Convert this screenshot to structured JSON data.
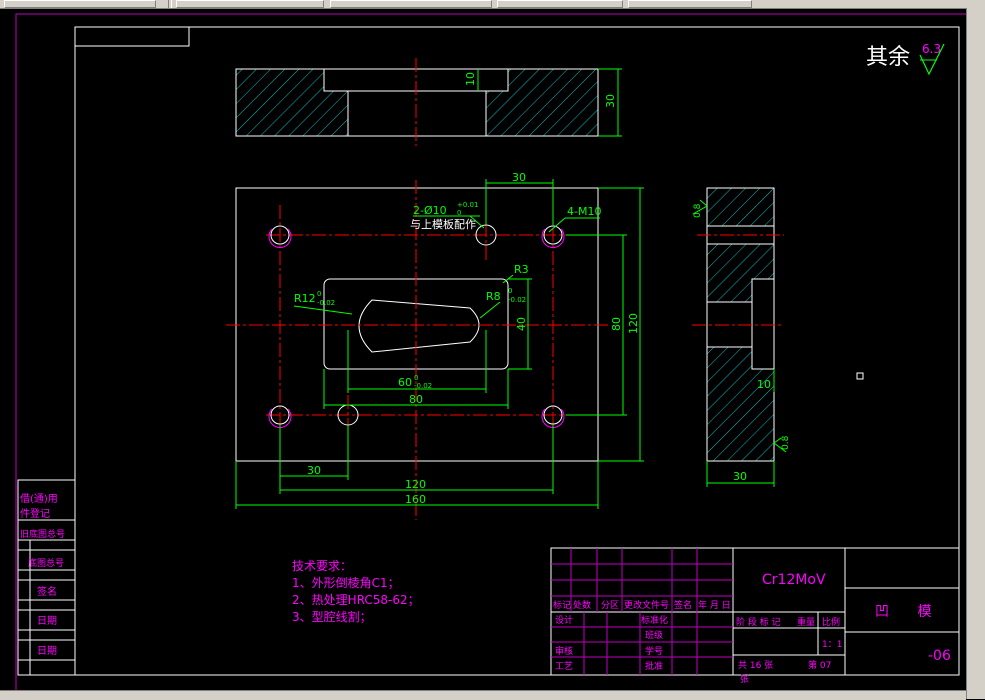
{
  "colors": {
    "background": "#000000",
    "border": "#c000c0",
    "outline": "#ffffff",
    "center_line": "#ff0000",
    "dimension": "#00ff00",
    "hatch": "#00c0c0",
    "notes": "#ff00ff"
  },
  "toolbar": {
    "items": [
      "toolbar-control-1",
      "toolbar-control-2",
      "toolbar-control-3",
      "toolbar-control-4",
      "toolbar-control-5"
    ]
  },
  "drawing": {
    "roughness_label": "其余",
    "roughness_value": "6.3",
    "top_view": {
      "dim_depth": "10",
      "dim_height": "30"
    },
    "plan_view": {
      "dim_hole_spacing": "30",
      "note_holes": "2-Ø10",
      "note_holes_tol": "+0.01",
      "note_holes_tol_low": "0",
      "note_fit": "与上模板配作",
      "note_thread": "4-M10",
      "note_r3": "R3",
      "note_r12": "R12",
      "note_r12_tol_up": "0",
      "note_r12_tol_low": "-0.02",
      "note_r8": "R8",
      "note_r8_tol_up": "0",
      "note_r8_tol_low": "-0.02",
      "dim_40": "40",
      "dim_80_v": "80",
      "dim_120_v": "120",
      "dim_60": "60",
      "dim_60_tol_up": "0",
      "dim_60_tol_low": "-0.02",
      "dim_80_h": "80",
      "dim_30_bottom": "30",
      "dim_120_h": "120",
      "dim_160": "160"
    },
    "side_view": {
      "roughness_top": "0.8",
      "dim_10": "10",
      "roughness_bottom": "0.8",
      "dim_30": "30"
    },
    "notes": {
      "title": "技术要求：",
      "line1": "1、外形倒棱角C1；",
      "line2": "2、热处理HRC58-62；",
      "line3": "3、型腔线割；"
    },
    "left_strip": {
      "field1": "借(通)用",
      "field2": "件登记",
      "field3": "旧底图总号",
      "field4": "底图总号",
      "field5": "签名",
      "field6": "日期",
      "field7": "日期"
    },
    "title_block": {
      "material": "Cr12MoV",
      "part_name": "凹 模",
      "drawing_no": "-06",
      "hdr_mark": "标记",
      "hdr_count": "处数",
      "hdr_zone": "分区",
      "hdr_change": "更改文件号",
      "hdr_sign": "签名",
      "hdr_date": "年 月 日",
      "design": "设计",
      "standardize": "标准化",
      "class": "班级",
      "review": "审核",
      "student_no": "学号",
      "process": "工艺",
      "approve": "批准",
      "stage_marks": "阶 段 标 记",
      "weight": "重量",
      "scale_label": "比例",
      "scale": "1：1",
      "sheets_total": "共 16  张",
      "sheet_no": "第 07",
      "sheet_unit": "张"
    }
  }
}
